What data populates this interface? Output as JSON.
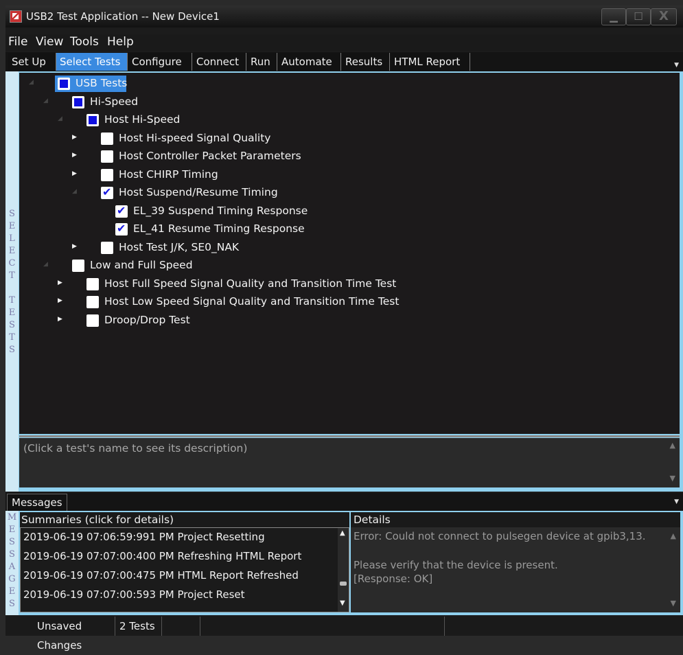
{
  "window": {
    "title": "USB2 Test Application -- New Device1",
    "controls": {
      "minimize": "▁",
      "maximize": "☐",
      "close": "X"
    }
  },
  "menu": {
    "items": [
      "File",
      "View",
      "Tools",
      "Help"
    ]
  },
  "tabs": {
    "items": [
      "Set Up",
      "Select Tests",
      "Configure",
      "Connect",
      "Run",
      "Automate",
      "Results",
      "HTML Report"
    ],
    "active": "Select Tests"
  },
  "select_tests_panel": {
    "vertical_label": [
      "S",
      "E",
      "L",
      "E",
      "C",
      "T",
      "",
      "T",
      "E",
      "S",
      "T",
      "S"
    ],
    "tree": [
      {
        "label": "USB Tests",
        "state": "partial",
        "level": 0,
        "expanded": true,
        "selected": true
      },
      {
        "label": "Hi-Speed",
        "state": "partial",
        "level": 1,
        "expanded": true
      },
      {
        "label": "Host Hi-Speed",
        "state": "partial",
        "level": 2,
        "expanded": true
      },
      {
        "label": "Host Hi-speed Signal Quality",
        "state": "unchecked",
        "level": 3,
        "expanded": false
      },
      {
        "label": "Host Controller Packet Parameters",
        "state": "unchecked",
        "level": 3,
        "expanded": false
      },
      {
        "label": "Host CHIRP Timing",
        "state": "unchecked",
        "level": 3,
        "expanded": false
      },
      {
        "label": "Host Suspend/Resume Timing",
        "state": "checked",
        "level": 3,
        "expanded": true
      },
      {
        "label": "EL_39 Suspend Timing Response",
        "state": "checked",
        "level": 4,
        "leaf": true
      },
      {
        "label": "EL_41 Resume Timing Response",
        "state": "checked",
        "level": 4,
        "leaf": true
      },
      {
        "label": "Host Test J/K, SE0_NAK",
        "state": "unchecked",
        "level": 3,
        "expanded": false
      },
      {
        "label": "Low and Full Speed",
        "state": "unchecked",
        "level": 1,
        "expanded": true
      },
      {
        "label": "Host Full Speed Signal Quality and Transition Time Test",
        "state": "unchecked",
        "level": 2,
        "expanded": false
      },
      {
        "label": "Host Low Speed Signal Quality and Transition Time Test",
        "state": "unchecked",
        "level": 2,
        "expanded": false
      },
      {
        "label": "Droop/Drop Test",
        "state": "unchecked",
        "level": 2,
        "expanded": false
      }
    ],
    "description_placeholder": "(Click a test's name to see its description)"
  },
  "messages": {
    "tab_label": "Messages",
    "vertical_label": [
      "M",
      "E",
      "S",
      "S",
      "A",
      "G",
      "E",
      "S"
    ],
    "summaries_header": "Summaries (click for details)",
    "summaries": [
      "2019-06-19 07:06:59:991 PM Project Resetting",
      "2019-06-19 07:07:00:400 PM Refreshing HTML Report",
      "2019-06-19 07:07:00:475 PM HTML Report Refreshed",
      "2019-06-19 07:07:00:593 PM Project Reset"
    ],
    "details_header": "Details",
    "details": [
      "Error: Could not connect to pulsegen device at gpib3,13.",
      "",
      "Please verify that the device is present.",
      "[Response: OK]"
    ]
  },
  "status": {
    "unsaved": "Unsaved Changes",
    "tests": "2 Tests"
  },
  "colors": {
    "accent": "#3a8ae0",
    "frame": "#8fd0ee",
    "check": "#1a1ae0"
  }
}
